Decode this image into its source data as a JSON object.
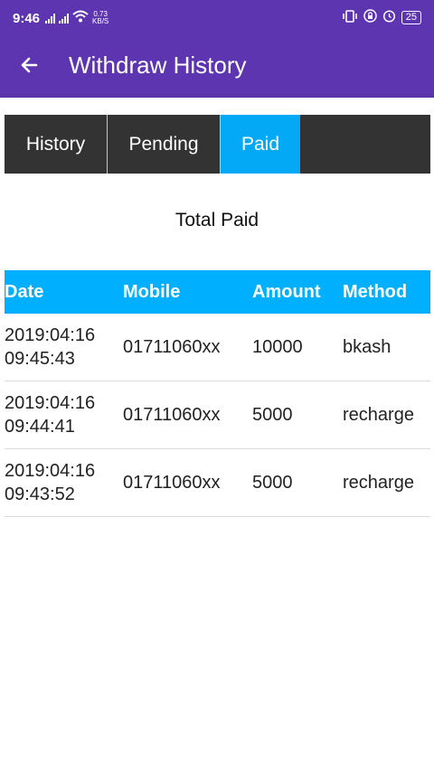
{
  "status_bar": {
    "time": "9:46",
    "net_speed_value": "0.73",
    "net_speed_unit": "KB/S",
    "battery": "25"
  },
  "appbar": {
    "title": "Withdraw History"
  },
  "tabs": [
    {
      "label": "History",
      "active": false
    },
    {
      "label": "Pending",
      "active": false
    },
    {
      "label": "Paid",
      "active": true
    }
  ],
  "section_title": "Total Paid",
  "table": {
    "headers": [
      "Date",
      "Mobile",
      "Amount",
      "Method"
    ],
    "rows": [
      {
        "date": "2019:04:16",
        "time": "09:45:43",
        "mobile": "01711060xx",
        "amount": "10000",
        "method": "bkash"
      },
      {
        "date": "2019:04:16",
        "time": "09:44:41",
        "mobile": "01711060xx",
        "amount": "5000",
        "method": "recharge"
      },
      {
        "date": "2019:04:16",
        "time": "09:43:52",
        "mobile": "01711060xx",
        "amount": "5000",
        "method": "recharge"
      }
    ]
  },
  "colors": {
    "appbar": "#5e35b1",
    "tab_bg": "#333333",
    "tab_active": "#03a9f4",
    "table_header": "#00b0ff"
  }
}
